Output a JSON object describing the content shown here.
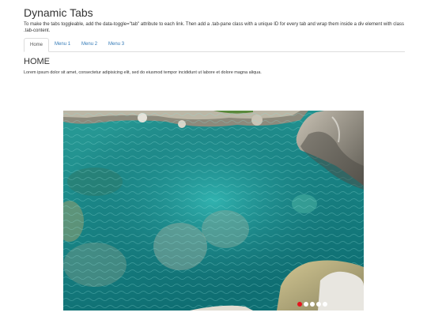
{
  "page": {
    "title": "Dynamic Tabs",
    "description": "To make the tabs toggleable, add the data-toggle=\"tab\" attribute to each link. Then add a .tab-pane class with a unique ID for every tab and wrap them inside a div element with class .tab-content."
  },
  "tabs": [
    {
      "label": "Home",
      "active": true
    },
    {
      "label": "Menu 1",
      "active": false
    },
    {
      "label": "Menu 2",
      "active": false
    },
    {
      "label": "Menu 3",
      "active": false
    }
  ],
  "pane": {
    "title": "HOME",
    "text": "Lorem ipsum dolor sit amet, consectetur adipisicing elit, sed do eiusmod tempor incididunt ut labore et dolore magna aliqua."
  },
  "carousel": {
    "slide_count": 6,
    "active_index": 0,
    "colors": {
      "active_dot": "#e6141e",
      "dot": "#ffffff",
      "water": "#1f8f8c",
      "rock": "#b9ae8c"
    }
  }
}
